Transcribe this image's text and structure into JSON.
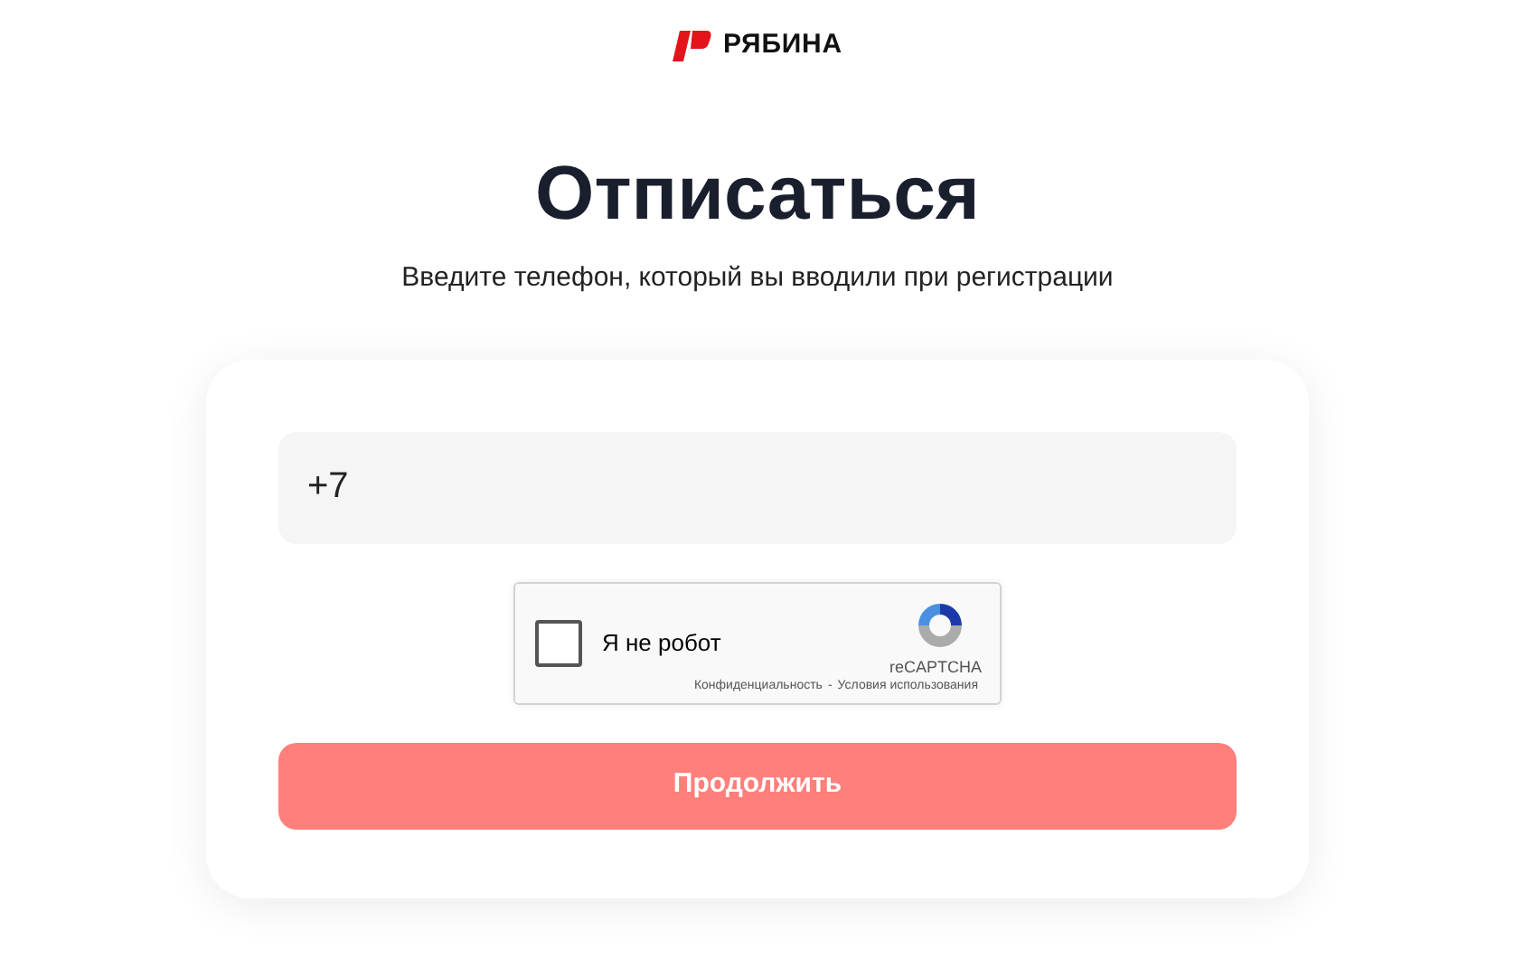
{
  "logo": {
    "text": "РЯБИНА"
  },
  "heading": "Отписаться",
  "subtitle": "Введите телефон, который вы вводили при регистрации",
  "phone_field": {
    "value": "+7"
  },
  "captcha": {
    "label": "Я не робот",
    "checked": false,
    "brand": "reCAPTCHA",
    "privacy": "Конфиденциальность",
    "separator": "-",
    "terms": "Условия использования"
  },
  "submit_button": {
    "label": "Продолжить",
    "disabled": true
  }
}
